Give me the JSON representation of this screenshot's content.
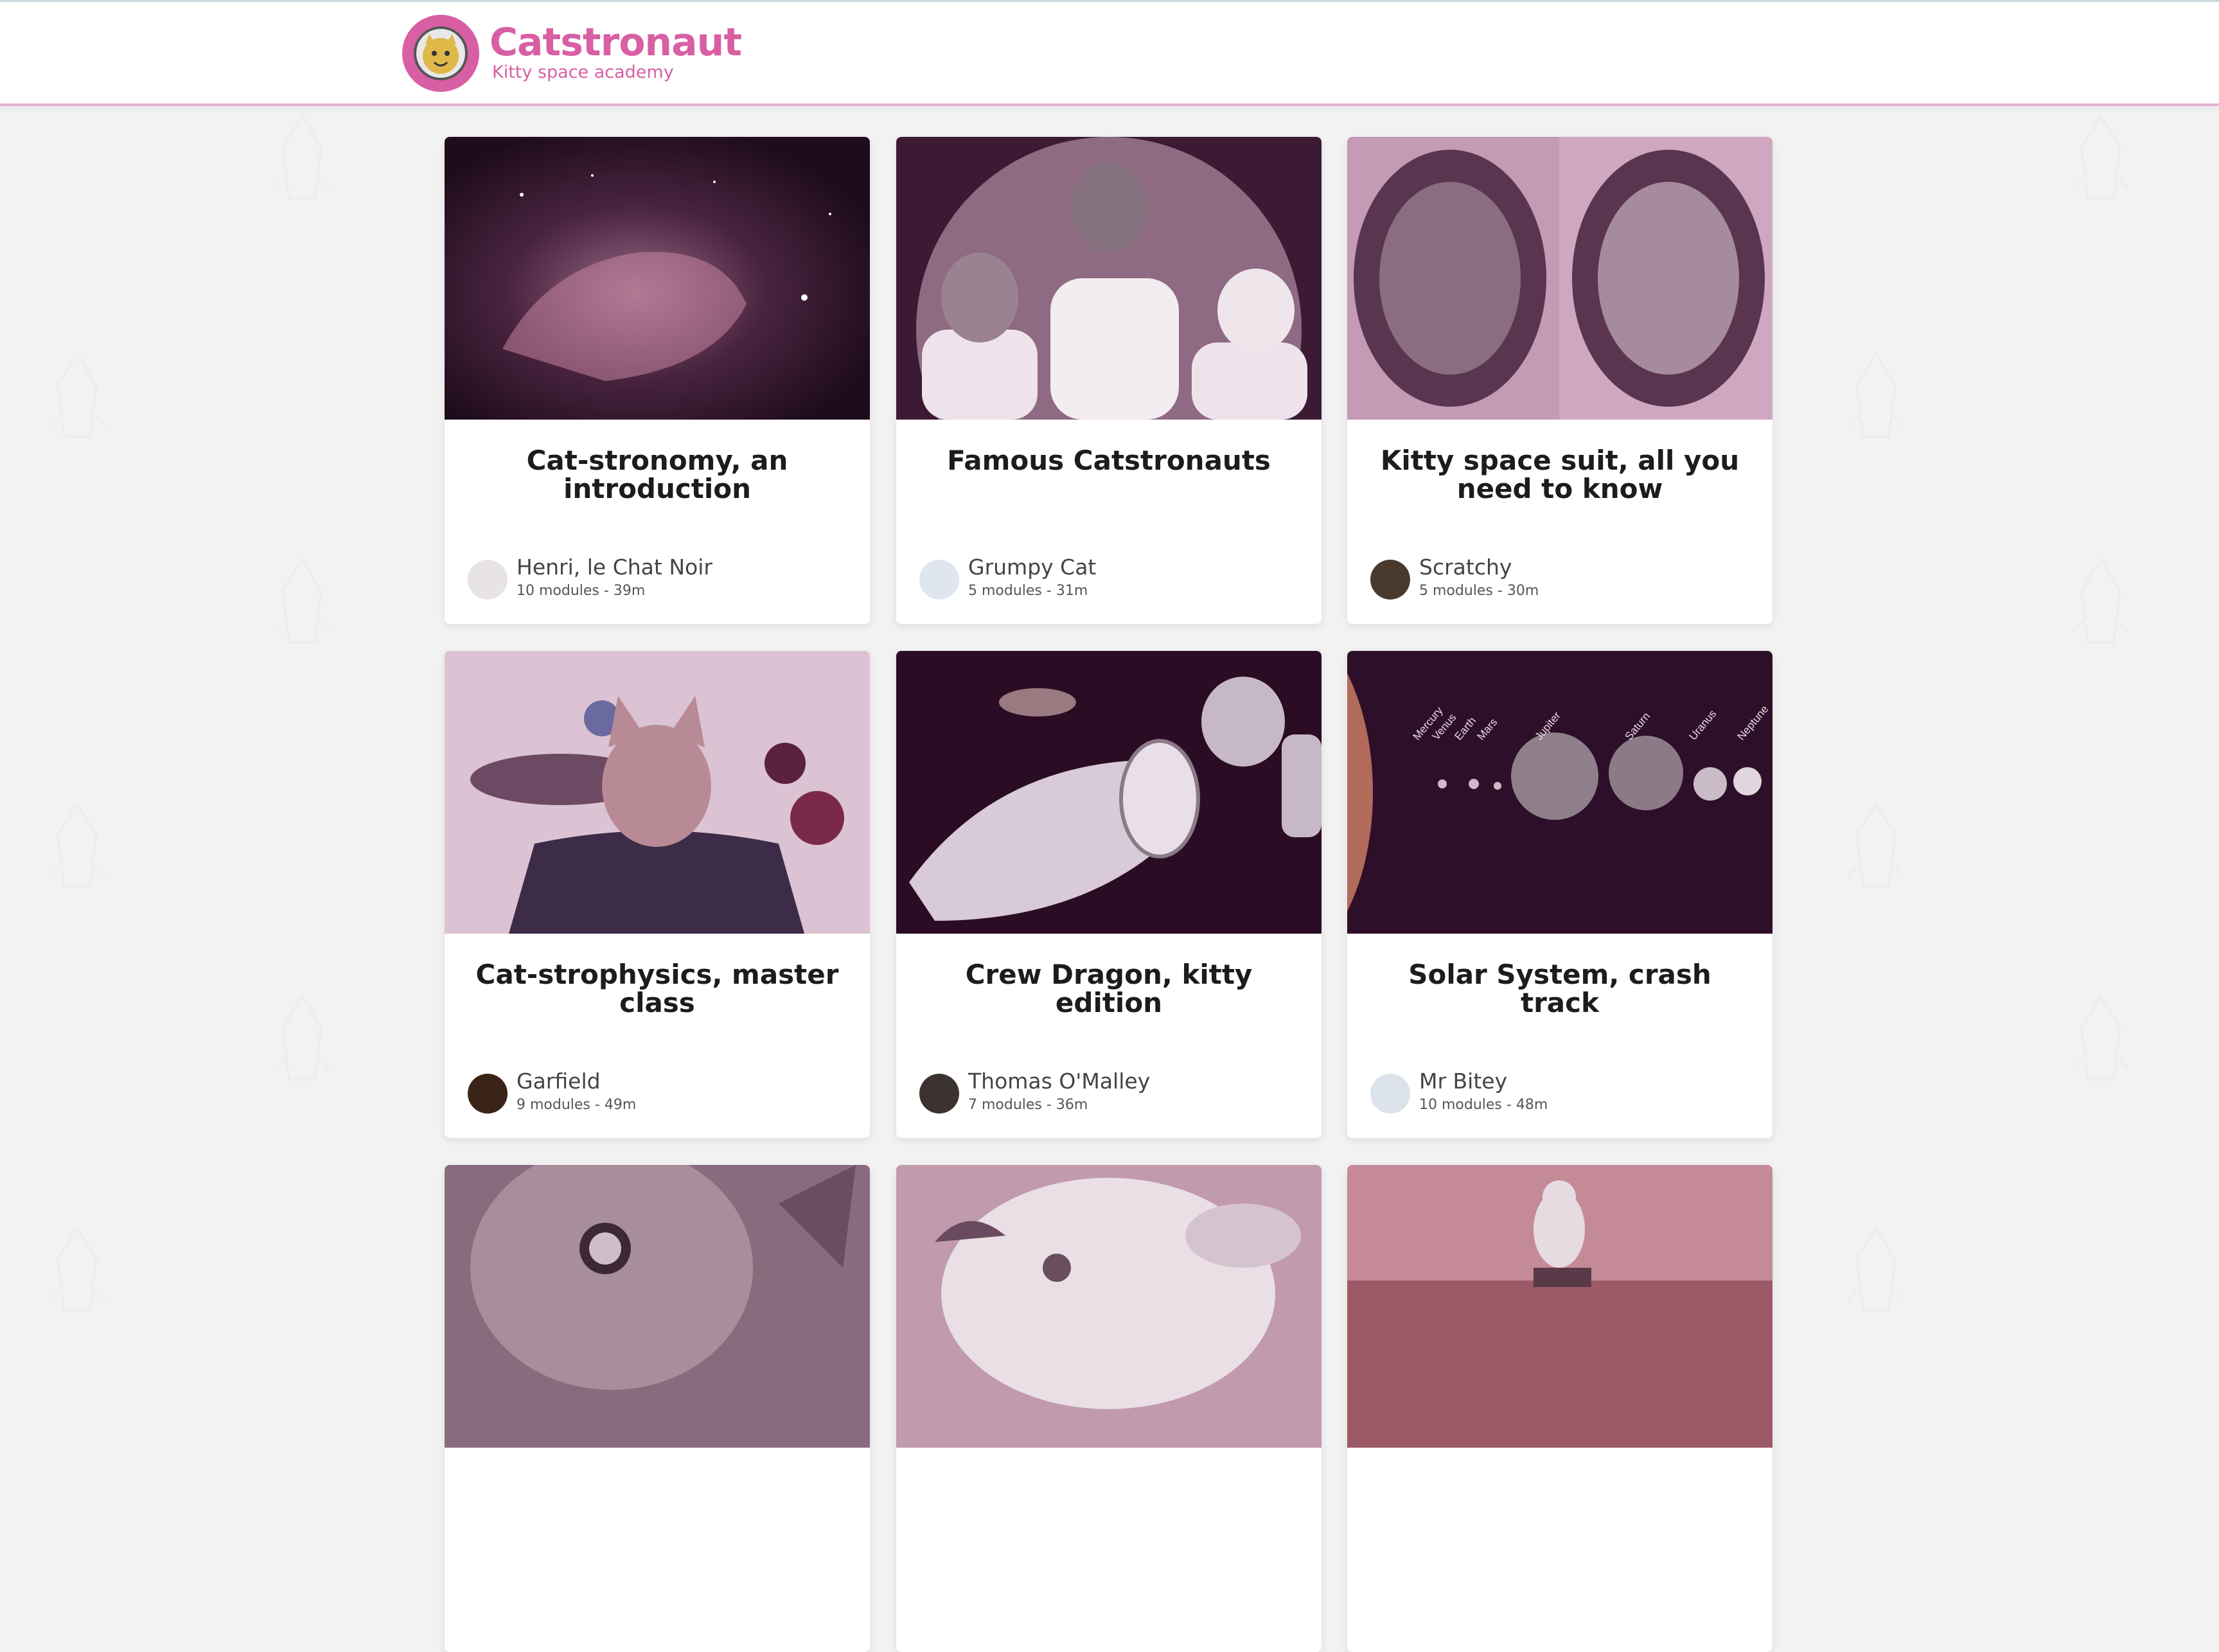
{
  "header": {
    "brand_title": "Catstronaut",
    "brand_subtitle": "Kitty space academy",
    "logo_icon": "astronaut-cat-icon"
  },
  "colors": {
    "brand": "#d85fa3",
    "background": "#f3f2f3",
    "card": "#ffffff",
    "thumb_tint": "#5a2548"
  },
  "tracks": [
    {
      "title": "Cat-stronomy, an introduction",
      "author": "Henri, le Chat Noir",
      "meta": "10 modules - 39m",
      "image": "nebula-cat-image"
    },
    {
      "title": "Famous Catstronauts",
      "author": "Grumpy Cat",
      "meta": "5 modules - 31m",
      "image": "three-cat-astronauts-image"
    },
    {
      "title": "Kitty space suit, all you need to know",
      "author": "Scratchy",
      "meta": "5 modules - 30m",
      "image": "cats-in-helmets-image"
    },
    {
      "title": "Cat-strophysics, master class",
      "author": "Garfield",
      "meta": "9 modules - 49m",
      "image": "cat-in-suit-image"
    },
    {
      "title": "Crew Dragon, kitty edition",
      "author": "Thomas O'Malley",
      "meta": "7 modules - 36m",
      "image": "cat-on-spacecraft-image"
    },
    {
      "title": "Solar System, crash track",
      "author": "Mr Bitey",
      "meta": "10 modules - 48m",
      "image": "cat-planets-image"
    },
    {
      "title": "",
      "author": "",
      "meta": "",
      "image": "tabby-cat-closeup-image"
    },
    {
      "title": "",
      "author": "",
      "meta": "",
      "image": "kitten-playing-image"
    },
    {
      "title": "",
      "author": "",
      "meta": "",
      "image": "cat-on-mars-image"
    }
  ],
  "planet_labels": [
    "Mercury",
    "Venus",
    "Earth",
    "Mars",
    "Jupiter",
    "Saturn",
    "Uranus",
    "Neptune"
  ]
}
